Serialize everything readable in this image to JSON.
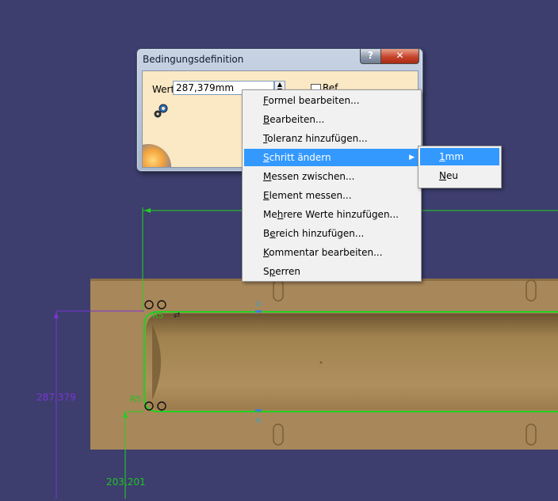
{
  "dialog": {
    "title": "Bedingungsdefinition",
    "help_label": "?",
    "close_label": "✕",
    "value_label": "Wert",
    "value": "287,379mm",
    "reference_label": "Ref"
  },
  "context_menu": {
    "items": [
      {
        "label": "Formel bearbeiten...",
        "accel": "F"
      },
      {
        "label": "Bearbeiten...",
        "accel": "B"
      },
      {
        "label": "Toleranz hinzufügen...",
        "accel": "T"
      },
      {
        "label": "Schritt ändern",
        "accel": "S",
        "highlighted": true,
        "submenu": true
      },
      {
        "label": "Messen zwischen...",
        "accel": "M"
      },
      {
        "label": "Element messen...",
        "accel": "E"
      },
      {
        "label": "Mehrere Werte hinzufügen...",
        "accel": "h"
      },
      {
        "label": "Bereich hinzufügen...",
        "accel": "e"
      },
      {
        "label": "Kommentar bearbeiten...",
        "accel": "K"
      },
      {
        "label": "Sperren",
        "accel": "p"
      }
    ],
    "submenu": [
      {
        "label": "1mm",
        "accel": "1",
        "highlighted": true
      },
      {
        "label": "Neu",
        "accel": "N"
      }
    ]
  },
  "viewport": {
    "dimension_vertical": "287,379",
    "dimension_horizontal": "203,201",
    "dimension_small_top": "R5",
    "dimension_small_bottom": "R5",
    "colors": {
      "background": "#3d3e6e",
      "part": "#a8875a",
      "sketch": "#1fd11f",
      "dimension_selected": "#7b34d6"
    }
  }
}
